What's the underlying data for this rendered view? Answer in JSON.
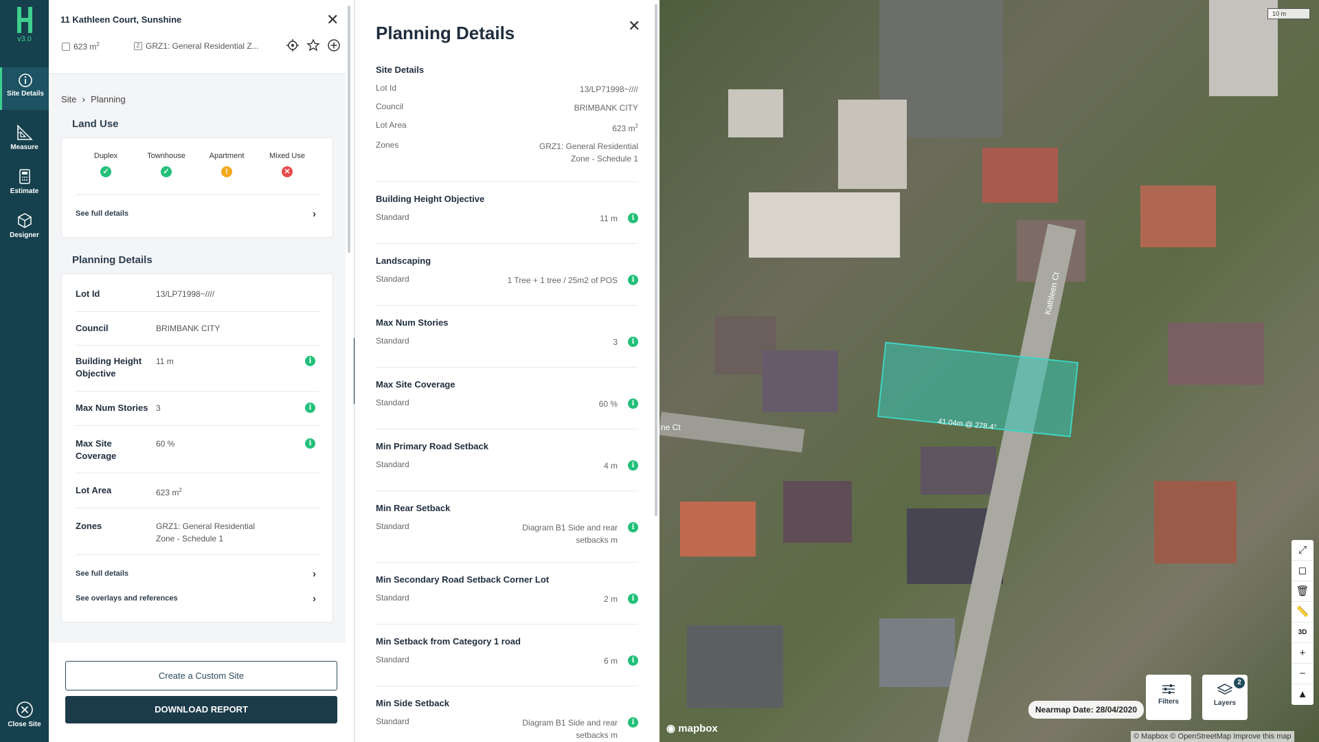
{
  "app": {
    "version": "v3.0"
  },
  "rail": {
    "items": [
      {
        "label": "Site Details",
        "active": true
      },
      {
        "label": "Measure"
      },
      {
        "label": "Estimate"
      },
      {
        "label": "Designer"
      }
    ],
    "close_label": "Close Site"
  },
  "site": {
    "address": "11 Kathleen Court, Sunshine",
    "area_value": "623 m",
    "area_sup": "2",
    "zone_short": "GRZ1: General Residential Z..."
  },
  "breadcrumb": {
    "root": "Site",
    "current": "Planning"
  },
  "land_use": {
    "title": "Land Use",
    "items": [
      {
        "label": "Duplex",
        "status": "allowed",
        "symbol": "✓",
        "color": "#22c07a"
      },
      {
        "label": "Townhouse",
        "status": "allowed",
        "symbol": "✓",
        "color": "#22c07a"
      },
      {
        "label": "Apartment",
        "status": "warning",
        "symbol": "!",
        "color": "#f2a91c"
      },
      {
        "label": "Mixed Use",
        "status": "not-allowed",
        "symbol": "✕",
        "color": "#e84a4a"
      }
    ],
    "see_full": "See full details"
  },
  "planning_card": {
    "title": "Planning Details",
    "rows": [
      {
        "key": "Lot Id",
        "value": "13/LP71998~////"
      },
      {
        "key": "Council",
        "value": "BRIMBANK CITY"
      },
      {
        "key": "Building Height Objective",
        "value": "11 m"
      },
      {
        "key": "Max Num Stories",
        "value": "3"
      },
      {
        "key": "Max Site Coverage",
        "value": "60 %"
      },
      {
        "key": "Lot Area",
        "value": "623 m",
        "sup": "2"
      },
      {
        "key": "Zones",
        "value": "GRZ1: General Residential Zone - Schedule 1"
      }
    ],
    "see_full": "See full details",
    "see_overlays": "See overlays and references"
  },
  "buttons": {
    "custom_site": "Create a Custom Site",
    "download": "DOWNLOAD REPORT"
  },
  "details": {
    "title": "Planning Details",
    "site_section": "Site Details",
    "site_rows": [
      {
        "key": "Lot Id",
        "value": "13/LP71998~////"
      },
      {
        "key": "Council",
        "value": "BRIMBANK CITY"
      },
      {
        "key": "Lot Area",
        "value": "623 m",
        "sup": "2"
      },
      {
        "key": "Zones",
        "value": "GRZ1: General Residential Zone - Schedule 1"
      }
    ],
    "sections": [
      {
        "title": "Building Height Objective",
        "key": "Standard",
        "value": "11 m"
      },
      {
        "title": "Landscaping",
        "key": "Standard",
        "value": "1 Tree + 1 tree / 25m2 of POS"
      },
      {
        "title": "Max Num Stories",
        "key": "Standard",
        "value": "3"
      },
      {
        "title": "Max Site Coverage",
        "key": "Standard",
        "value": "60 %"
      },
      {
        "title": "Min Primary Road Setback",
        "key": "Standard",
        "value": "4 m"
      },
      {
        "title": "Min Rear Setback",
        "key": "Standard",
        "value": "Diagram B1 Side and rear setbacks m"
      },
      {
        "title": "Min Secondary Road Setback Corner Lot",
        "key": "Standard",
        "value": "2 m"
      },
      {
        "title": "Min Setback from Category 1 road",
        "key": "Standard",
        "value": "6 m"
      },
      {
        "title": "Min Side Setback",
        "key": "Standard",
        "value": "Diagram B1 Side and rear setbacks m"
      }
    ]
  },
  "map": {
    "scale": "10 m",
    "lot_label": "41.04m @ 278.4°",
    "street_label": "Kathleen Ct",
    "street_label2": "ne Ct",
    "nearmap_date": "Nearmap Date: 28/04/2020",
    "filters_label": "Filters",
    "layers_label": "Layers",
    "layers_count": "2",
    "mapbox_label": "mapbox",
    "attribution": "© Mapbox © OpenStreetMap  Improve this map",
    "lot_color": "#36c4b4"
  }
}
